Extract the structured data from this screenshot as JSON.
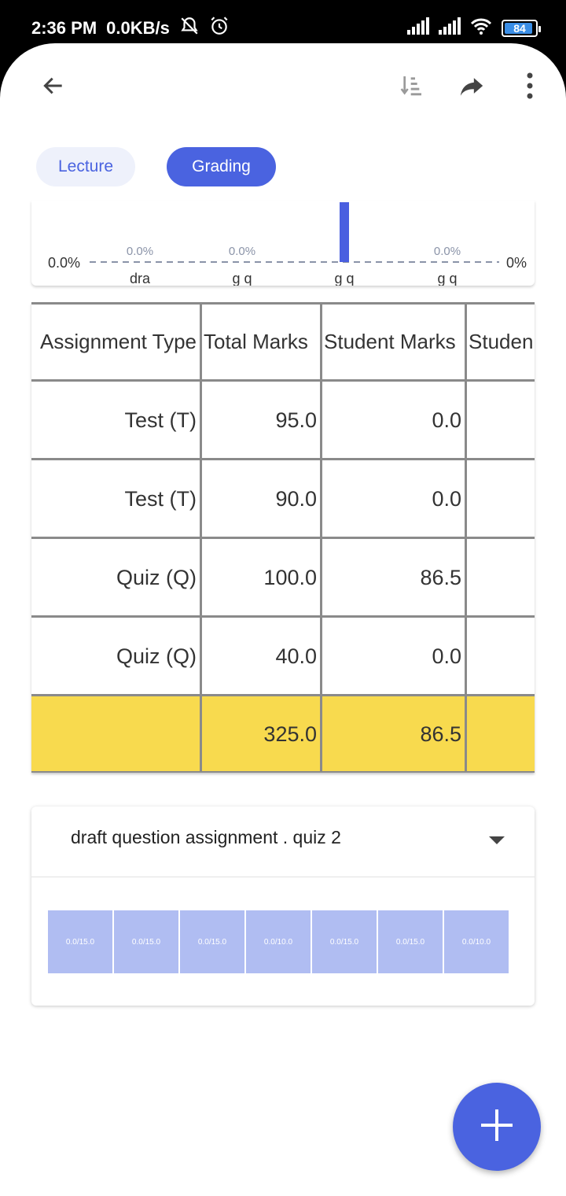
{
  "status_bar": {
    "time": "2:36 PM",
    "speed": "0.0KB/s",
    "battery": "84",
    "icons": [
      "bell-off-icon",
      "alarm-icon",
      "signal-icon",
      "signal-icon",
      "wifi-icon",
      "battery-icon"
    ]
  },
  "toolbar": {
    "back_icon": "arrow-back-icon",
    "sort_icon": "sort-icon",
    "share_icon": "share-icon",
    "more_icon": "more-vert-icon"
  },
  "tabs": [
    {
      "label": "Lecture",
      "selected": false
    },
    {
      "label": "Grading",
      "selected": true
    }
  ],
  "chart": {
    "left_label": "0.0%",
    "right_label": "0%",
    "categories": [
      "dra",
      "g q",
      "g q",
      "g q"
    ],
    "value_labels": [
      "0.0%",
      "0.0%",
      "",
      "0.0%"
    ]
  },
  "chart_data": {
    "type": "bar",
    "categories": [
      "dra",
      "g q",
      "g q",
      "g q"
    ],
    "values": [
      0.0,
      0.0,
      26.6,
      0.0
    ],
    "data_labels": [
      "0.0%",
      "0.0%",
      "",
      "0.0%"
    ],
    "y_left_label": "0.0%",
    "y_right_label": "0%",
    "colors": {
      "bar": "#4a5fe0",
      "baseline": "#8a93a8"
    }
  },
  "table": {
    "headers": [
      "Assignment Type",
      "Total Marks",
      "Student Marks",
      "Studen"
    ],
    "rows": [
      [
        "Test (T)",
        "95.0",
        "0.0",
        ""
      ],
      [
        "Test (T)",
        "90.0",
        "0.0",
        ""
      ],
      [
        "Quiz (Q)",
        "100.0",
        "86.5",
        ""
      ],
      [
        "Quiz (Q)",
        "40.0",
        "0.0",
        ""
      ]
    ],
    "totals": [
      "",
      "325.0",
      "86.5",
      ""
    ],
    "colors": {
      "totals_bg": "#f8da4e",
      "grid": "#8a8a8a"
    }
  },
  "assignment": {
    "title": "draft question assignment . quiz 2",
    "scores": [
      "0.0/15.0",
      "0.0/15.0",
      "0.0/15.0",
      "0.0/10.0",
      "0.0/15.0",
      "0.0/15.0",
      "0.0/10.0"
    ]
  },
  "fab": {
    "icon": "plus-icon"
  },
  "colors": {
    "accent": "#4a63e0",
    "chip_light": "#eef1fb",
    "tile": "#b0bdf2"
  }
}
